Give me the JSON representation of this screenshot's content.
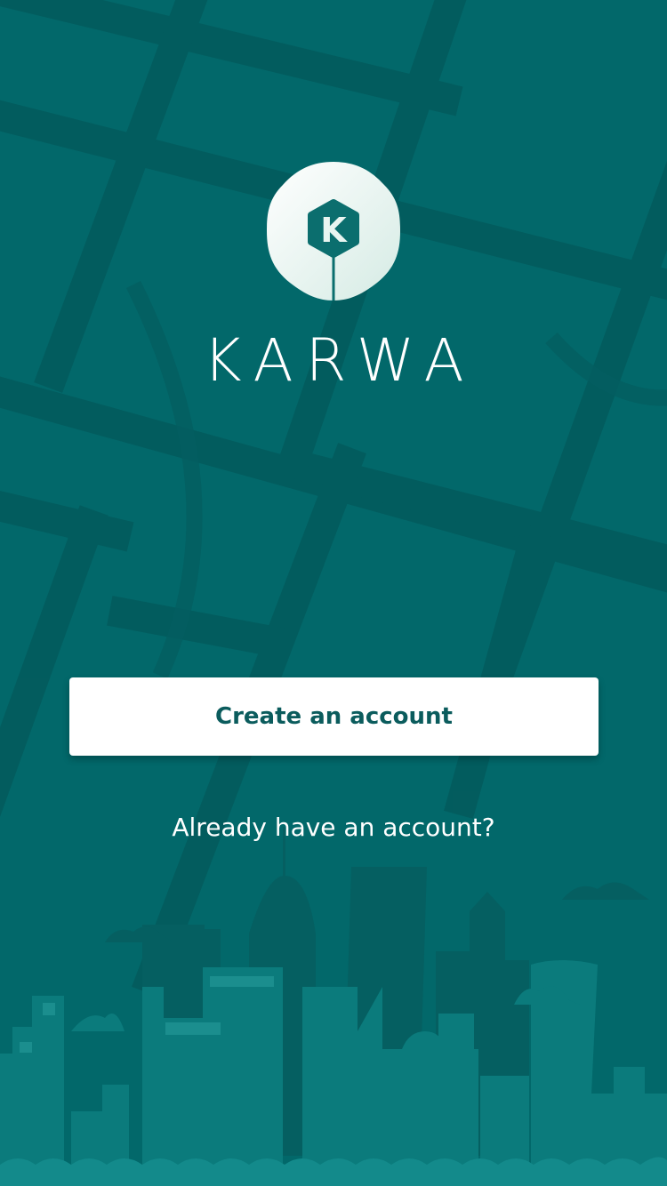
{
  "brand": {
    "logo_letter": "K",
    "name": "KARWA"
  },
  "actions": {
    "create_account_label": "Create an account",
    "login_label": "Already have an account?"
  },
  "icons": {
    "logo": "karwa-pin-logo-icon"
  },
  "colors": {
    "background": "#02686a",
    "map_lines": "#035a5c",
    "skyline_far": "#055f61",
    "skyline_near": "#0b7b7c",
    "button_text": "#0b5c5d",
    "button_bg": "#ffffff"
  }
}
